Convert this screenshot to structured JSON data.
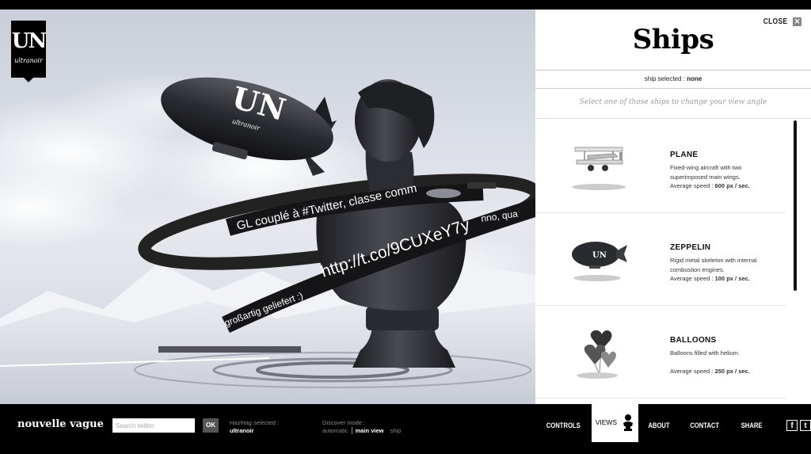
{
  "scene": {
    "logo": {
      "mark": "UN",
      "word": "ultranoir"
    },
    "blimp_logo": {
      "mark": "UN",
      "word": "ultranoir"
    },
    "ribbon": {
      "text_top": "GL couplé à #Twitter, classe comm",
      "text_top_right": "nno, qua",
      "text_url": "http://t.co/9CUXeY7y",
      "text_left": "großartig geliefert :)"
    }
  },
  "panel": {
    "close_label": "CLOSE",
    "close_icon": "close-x-icon",
    "title": "Ships",
    "selected_label": "ship selected :",
    "selected_value": "none",
    "hint": "Select one of those ships to change your view angle",
    "ships": [
      {
        "name": "PLANE",
        "desc": "Fixed-wing aircraft with two superimposed main wings.",
        "speed_label": "Average speed :",
        "speed_value": "600 px / sec.",
        "icon": "biplane-icon"
      },
      {
        "name": "ZEPPELIN",
        "desc": "Rigid metal skeleton with internal combustion engines.",
        "speed_label": "Average speed :",
        "speed_value": "100 px / sec.",
        "icon": "zeppelin-icon"
      },
      {
        "name": "BALLOONS",
        "desc": "Balloons filled with helium.",
        "speed_label": "Average speed :",
        "speed_value": "250 px / sec.",
        "icon": "balloons-icon"
      }
    ]
  },
  "bottombar": {
    "brand": "nouvelle vague",
    "search_placeholder": "Search twitter",
    "ok_label": "OK",
    "hashtag_label": "Hashtag selected :",
    "hashtag_value": "ultranoir",
    "discover_label": "Discover mode :",
    "discover_modes": [
      "automatic",
      "main view",
      "ship"
    ],
    "discover_active": "main view",
    "nav": [
      "CONTROLS",
      "VIEWS",
      "ABOUT",
      "CONTACT",
      "SHARE THIS"
    ],
    "social": [
      {
        "glyph": "f",
        "icon": "facebook-icon"
      },
      {
        "glyph": "t",
        "icon": "twitter-icon"
      }
    ]
  }
}
